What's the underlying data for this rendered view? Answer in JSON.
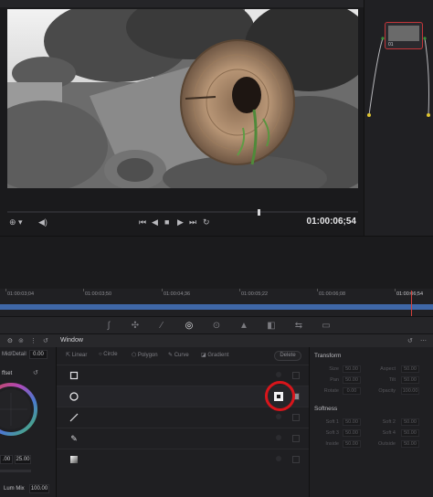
{
  "viewer": {
    "timecode": "01:00:06;54",
    "transport_icons": [
      "skip-start-icon",
      "step-back-icon",
      "stop-icon",
      "play-icon",
      "skip-end-icon",
      "loop-icon"
    ]
  },
  "node_graph": {
    "node_label": "01"
  },
  "timeline": {
    "ticks": [
      "01:00:03;04",
      "01:00:03;50",
      "01:00:04;36",
      "01:00:05;22",
      "01:00:06;08",
      "01:00:06;54"
    ]
  },
  "palette": {
    "window_title": "Window"
  },
  "color_panel": {
    "mid_detail_label": "Mid/Detail",
    "mid_detail_value": "0.00",
    "offset_label": "ffset",
    "offset_value_1": ".00",
    "offset_value_2": "25.00",
    "lum_mix_label": "Lum Mix",
    "lum_mix_value": "100.00"
  },
  "window_tools": {
    "tabs": [
      "Linear",
      "Circle",
      "Polygon",
      "Curve",
      "Gradient"
    ],
    "delete_label": "Delete",
    "shapes": [
      {
        "name": "square-window",
        "icon": "square-outline-icon"
      },
      {
        "name": "circle-window",
        "icon": "circle-outline-icon"
      },
      {
        "name": "linear-window",
        "icon": "line-icon"
      },
      {
        "name": "pen-window",
        "icon": "pen-icon"
      },
      {
        "name": "gradient-window",
        "icon": "gradient-icon"
      }
    ]
  },
  "transform": {
    "title": "Transform",
    "rows": [
      {
        "l1": "Size",
        "v1": "50.00",
        "l2": "Aspect",
        "v2": "50.00"
      },
      {
        "l1": "Pan",
        "v1": "50.00",
        "l2": "Tilt",
        "v2": "50.00"
      },
      {
        "l1": "Rotate",
        "v1": "0.00",
        "l2": "Opacity",
        "v2": "100.00"
      }
    ]
  },
  "softness": {
    "title": "Softness",
    "rows": [
      {
        "l1": "Soft 1",
        "v1": "50.00",
        "l2": "Soft 2",
        "v2": "50.00"
      },
      {
        "l1": "Soft 3",
        "v1": "50.00",
        "l2": "Soft 4",
        "v2": "50.00"
      },
      {
        "l1": "Inside",
        "v1": "50.00",
        "l2": "Outside",
        "v2": "50.00"
      }
    ]
  },
  "colors": {
    "accent_blue": "#3f67a7",
    "playhead_red": "#d6413b",
    "annotation_red": "#d8151b"
  }
}
